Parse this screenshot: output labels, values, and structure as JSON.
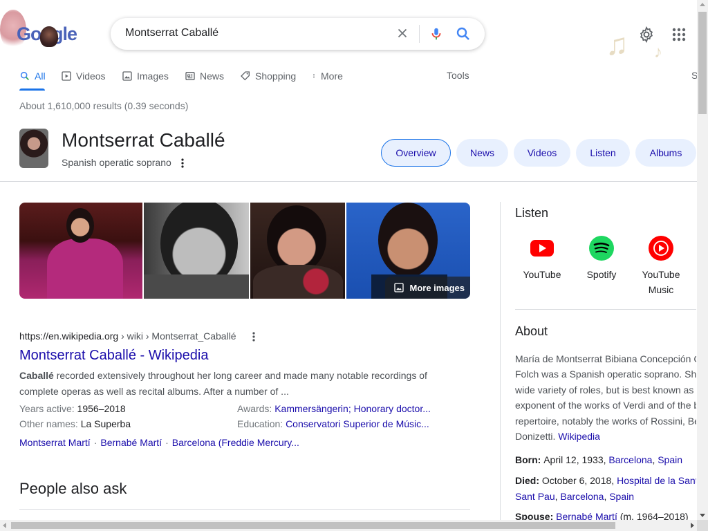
{
  "header": {
    "logo_text": "Google",
    "search_query": "Montserrat Caballé"
  },
  "tabs": [
    {
      "label": "All",
      "icon": "search-icon",
      "active": true
    },
    {
      "label": "Videos",
      "icon": "play-icon"
    },
    {
      "label": "Images",
      "icon": "image-icon"
    },
    {
      "label": "News",
      "icon": "newspaper-icon"
    },
    {
      "label": "Shopping",
      "icon": "tag-icon"
    },
    {
      "label": "More",
      "icon": "more-vert-icon"
    }
  ],
  "tools_label": "Tools",
  "right_cut_label": "S",
  "result_stats": "About 1,610,000 results (0.39 seconds)",
  "entity": {
    "title": "Montserrat Caballé",
    "subtitle": "Spanish operatic soprano",
    "chips": [
      "Overview",
      "News",
      "Videos",
      "Listen",
      "Albums"
    ]
  },
  "images": {
    "more_label": "More images"
  },
  "result": {
    "url_domain": "https://en.wikipedia.org",
    "url_path": " › wiki › Montserrat_Caballé",
    "title": "Montserrat Caballé - Wikipedia",
    "snippet_bold": "Caballé",
    "snippet_rest": " recorded extensively throughout her long career and made many notable recordings of complete operas as well as recital albums. After a number of ...",
    "facts": [
      {
        "key": "Years active: ",
        "value": "1956–2018",
        "link": false
      },
      {
        "key": "Awards: ",
        "value": "Kammersängerin; Honorary doctor...",
        "link": true
      },
      {
        "key": "Other names: ",
        "value": "La Superba",
        "link": false
      },
      {
        "key": "Education: ",
        "value": "Conservatori Superior de Músic...",
        "link": true
      }
    ],
    "related": [
      "Montserrat Martí",
      "Bernabé Martí",
      "Barcelona (Freddie Mercury..."
    ]
  },
  "people_also_ask": "People also ask",
  "side": {
    "listen_title": "Listen",
    "services": [
      {
        "name": "YouTube",
        "color": "#ff0000"
      },
      {
        "name": "Spotify",
        "color": "#1ed760"
      },
      {
        "name": "YouTube Music",
        "color": "#ff0000"
      }
    ],
    "about_title": "About",
    "about_lines": [
      "María de Montserrat Bibiana Concepción C",
      "Folch was a Spanish operatic soprano. Sh",
      "wide variety of roles, but is best known as",
      "exponent of the works of Verdi and of the b",
      "repertoire, notably the works of Rossini, Be",
      "Donizetti."
    ],
    "about_link": "Wikipedia",
    "born_key": "Born: ",
    "born_text": "April 12, 1933, ",
    "born_link1": "Barcelona",
    "born_link2": "Spain",
    "died_key": "Died: ",
    "died_text": "October 6, 2018, ",
    "died_link1": "Hospital de la Sant",
    "died_link2": "Sant Pau",
    "died_link3": "Barcelona",
    "died_link4": "Spain",
    "spouse_key": "Spouse: ",
    "spouse_link": "Bernabé Martí",
    "spouse_text": " (m. 1964–2018)"
  },
  "colors": {
    "link": "#1a0dab",
    "accent": "#1a73e8",
    "chip_bg": "#e8f0fe"
  }
}
